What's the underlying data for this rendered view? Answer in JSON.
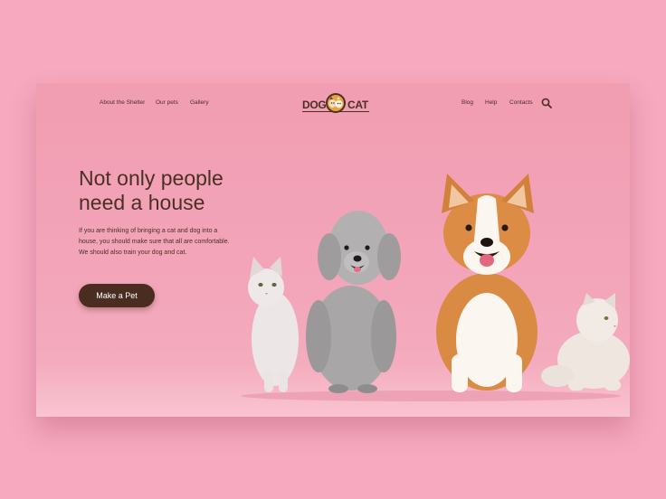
{
  "nav": {
    "left": [
      "About the Shelter",
      "Our pets",
      "Gallery"
    ],
    "right": [
      "Blog",
      "Help",
      "Contacts"
    ]
  },
  "logo": {
    "left": "DOG",
    "right": "CAT"
  },
  "hero": {
    "title": "Not only people need a house",
    "description": "If you are thinking of bringing a cat and dog into a house, you should make sure that all  are comfortable. We should also train your dog and cat.",
    "cta": "Make a Pet"
  },
  "icons": {
    "search": "search-icon"
  },
  "colors": {
    "background": "#f6a9bf",
    "card": "#f19db2",
    "text": "#4a3024",
    "button": "#4a2d20"
  }
}
